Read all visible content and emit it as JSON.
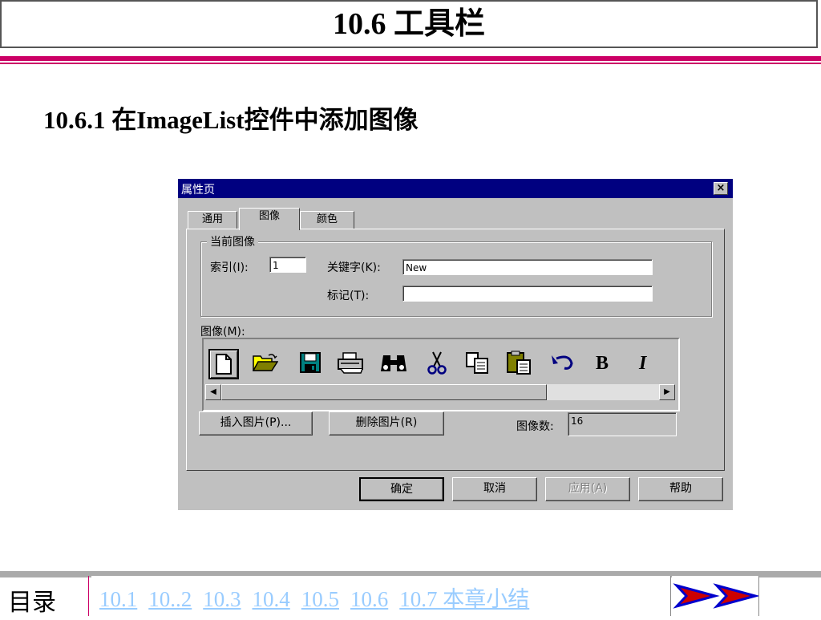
{
  "slide": {
    "title": "10.6  工具栏",
    "subtitle": "10.6.1  在ImageList控件中添加图像"
  },
  "dialog": {
    "caption": "属性页",
    "close_glyph": "×",
    "tabs": [
      {
        "label": "通用",
        "active": false
      },
      {
        "label": "图像",
        "active": true
      },
      {
        "label": "颜色",
        "active": false
      }
    ],
    "group_label": "当前图像",
    "index_label": "索引(I):",
    "index_value": "1",
    "key_label": "关键字(K):",
    "key_value": "New",
    "tag_label": "标记(T):",
    "tag_value": "",
    "images_label": "图像(M):",
    "images": [
      "new-file",
      "open-folder",
      "save-disk",
      "print",
      "find-binoculars",
      "cut-scissors",
      "copy",
      "paste",
      "undo",
      "bold",
      "italic"
    ],
    "insert_button": "插入图片(P)...",
    "delete_button": "删除图片(R)",
    "count_label": "图像数:",
    "count_value": "16",
    "ok_button": "确定",
    "cancel_button": "取消",
    "apply_button": "应用(A)",
    "help_button": "帮助"
  },
  "footer": {
    "toc_label": "目录",
    "links": [
      "10.1",
      "10..2",
      "10.3",
      "10.4",
      "10.5",
      "10.6",
      "10.7 本章小结"
    ],
    "colors": {
      "accent": "#cc0066",
      "link": "#99ccff",
      "arrow_red": "#cc0000",
      "arrow_blue": "#0000cc"
    }
  }
}
